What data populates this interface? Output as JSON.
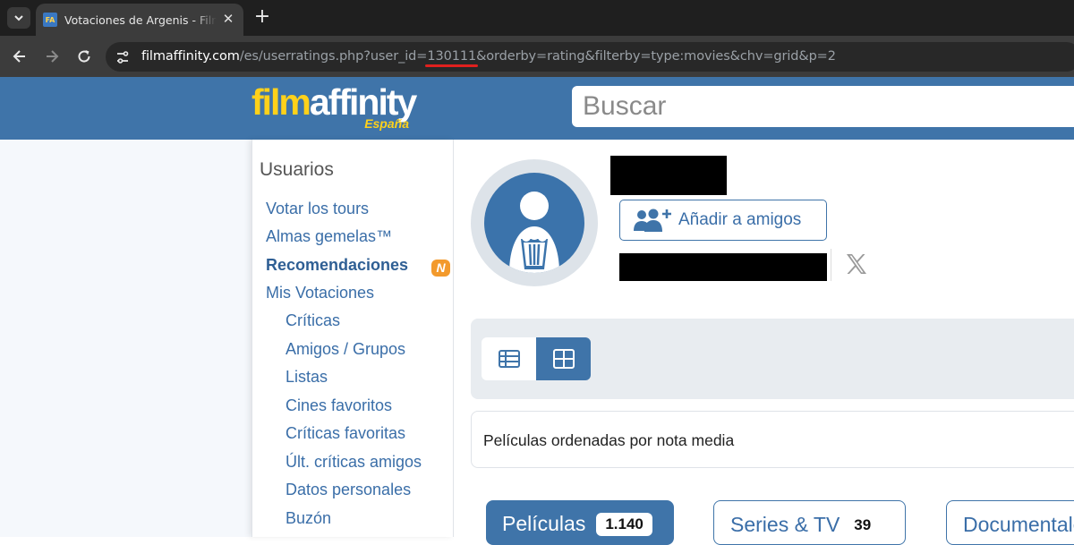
{
  "browser": {
    "tab_title": "Votaciones de Argenis - FilmAffinity",
    "tab_favicon_text": "FA",
    "url_host": "filmaffinity.com",
    "url_path_before_id": "/es/userratings.php?user_id=",
    "url_user_id": "130111",
    "url_path_after_id": "&orderby=rating&filterby=type:movies&chv=grid&p=2"
  },
  "header": {
    "logo_film": "film",
    "logo_affinity": "affinity",
    "logo_region": "España",
    "search_placeholder": "Buscar"
  },
  "sidebar": {
    "title": "Usuarios",
    "items": [
      {
        "label": "Votar los tours"
      },
      {
        "label": "Almas gemelas™"
      },
      {
        "label": "Recomendaciones",
        "badge": "N"
      },
      {
        "label": "Mis Votaciones"
      },
      {
        "label": "Críticas"
      },
      {
        "label": "Amigos / Grupos"
      },
      {
        "label": "Listas"
      },
      {
        "label": "Cines favoritos"
      },
      {
        "label": "Críticas favoritas"
      },
      {
        "label": "Últ. críticas amigos"
      },
      {
        "label": "Datos personales"
      },
      {
        "label": "Buzón"
      }
    ]
  },
  "profile": {
    "add_friend_label": "Añadir a amigos",
    "order_label": "Películas ordenadas por nota media"
  },
  "type_tabs": [
    {
      "label": "Películas",
      "count": "1.140"
    },
    {
      "label": "Series & TV",
      "count": "39"
    },
    {
      "label": "Documentales",
      "count": ""
    }
  ],
  "colors": {
    "brand_blue": "#3f74a9",
    "logo_yellow": "#ffd11a",
    "badge_orange": "#f39a2c",
    "underline_red": "#e0201e"
  }
}
